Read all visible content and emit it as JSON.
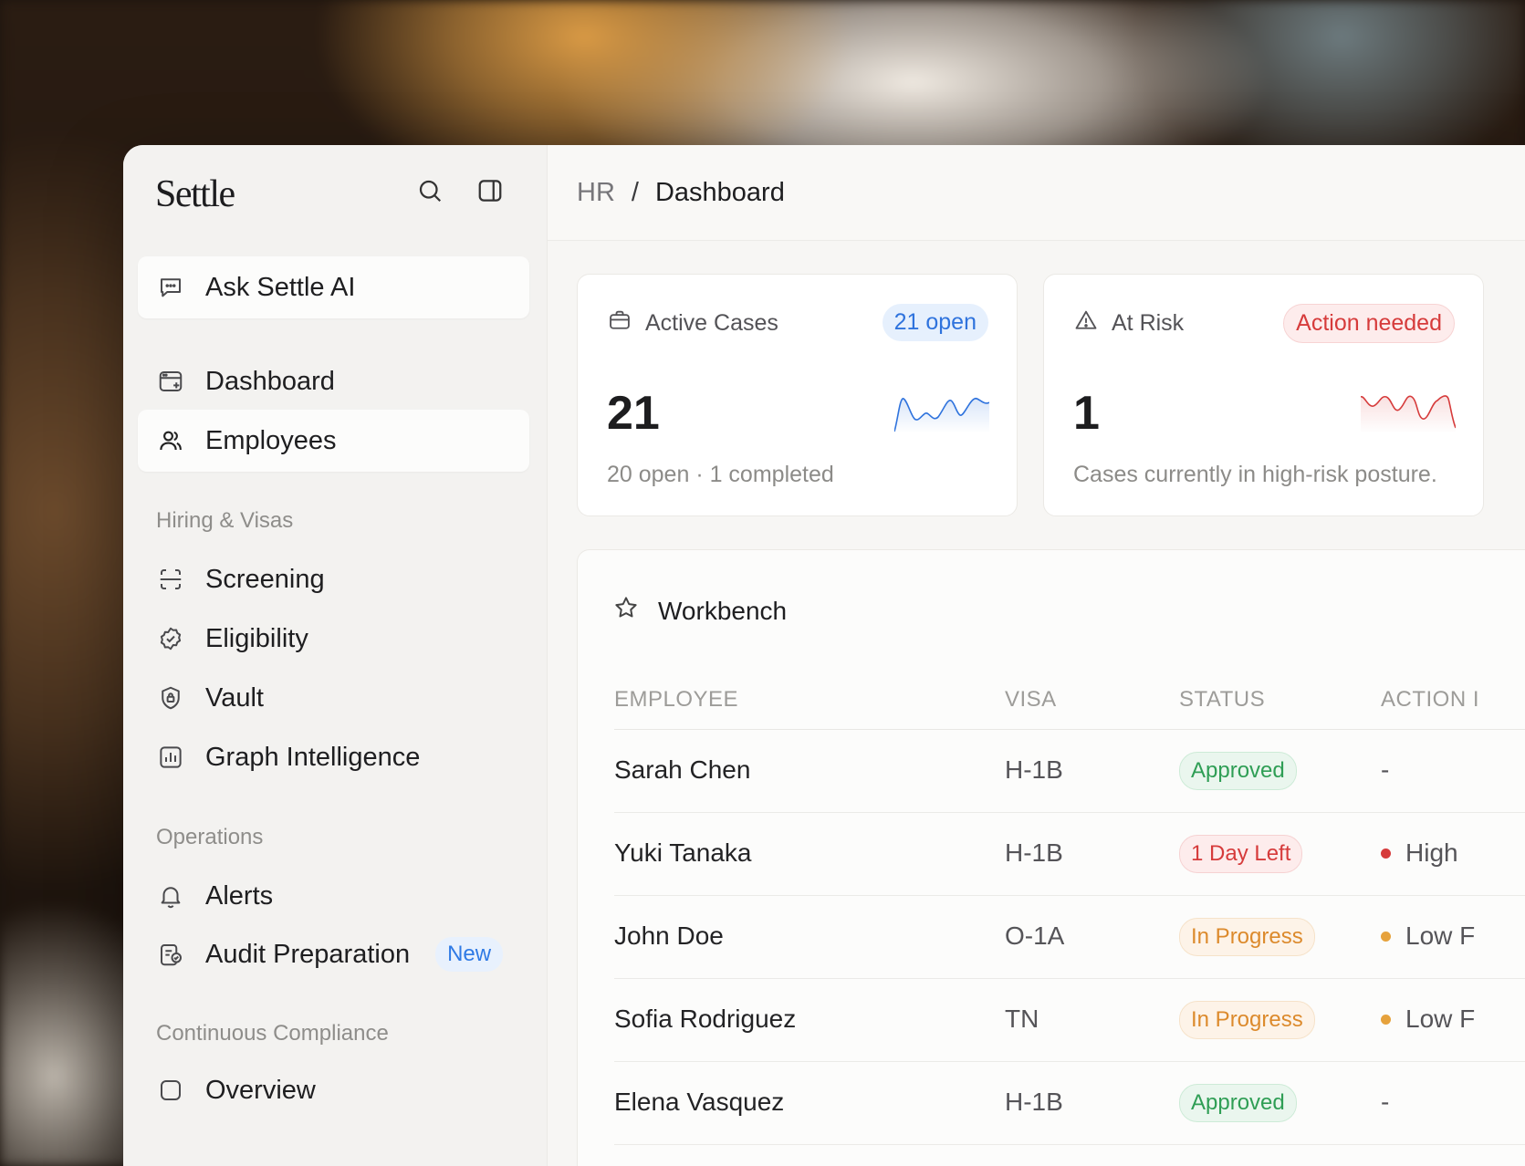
{
  "brand": "Settle",
  "sidebar": {
    "ask_ai": "Ask Settle AI",
    "items": [
      {
        "label": "Dashboard"
      },
      {
        "label": "Employees"
      }
    ],
    "sections": [
      {
        "label": "Hiring & Visas",
        "items": [
          "Screening",
          "Eligibility",
          "Vault",
          "Graph Intelligence"
        ]
      },
      {
        "label": "Operations",
        "items": [
          "Alerts",
          "Audit Preparation"
        ],
        "badge": "New"
      },
      {
        "label": "Continuous Compliance",
        "items": [
          "Overview"
        ]
      }
    ]
  },
  "breadcrumb": {
    "parent": "HR",
    "separator": "/",
    "current": "Dashboard"
  },
  "cards": {
    "active": {
      "title": "Active Cases",
      "pill": "21 open",
      "value": "21",
      "sub": "20 open · 1 completed"
    },
    "risk": {
      "title": "At Risk",
      "pill": "Action needed",
      "value": "1",
      "sub": "Cases currently in high-risk posture."
    }
  },
  "workbench": {
    "title": "Workbench",
    "columns": [
      "EMPLOYEE",
      "VISA",
      "STATUS",
      "ACTION I"
    ],
    "rows": [
      {
        "employee": "Sarah Chen",
        "visa": "H-1B",
        "status": "Approved",
        "action": "-"
      },
      {
        "employee": "Yuki Tanaka",
        "visa": "H-1B",
        "status": "1 Day Left",
        "action": "High"
      },
      {
        "employee": "John Doe",
        "visa": "O-1A",
        "status": "In Progress",
        "action": "Low F"
      },
      {
        "employee": "Sofia Rodriguez",
        "visa": "TN",
        "status": "In Progress",
        "action": "Low F"
      },
      {
        "employee": "Elena Vasquez",
        "visa": "H-1B",
        "status": "Approved",
        "action": "-"
      }
    ]
  },
  "colors": {
    "accent_blue": "#2f73dd",
    "danger_red": "#d63b3b",
    "success_green": "#2f9e55",
    "warning_orange": "#dc8a2c"
  },
  "icons": {
    "search": "search-icon",
    "sidebar_toggle": "sidebar-toggle-icon",
    "chat": "chat-icon",
    "dashboard": "dashboard-icon",
    "employees": "users-icon",
    "screening": "scan-icon",
    "eligibility": "badge-check-icon",
    "vault": "shield-lock-icon",
    "graph": "chart-icon",
    "alerts": "bell-icon",
    "audit": "clipboard-icon",
    "briefcase": "briefcase-icon",
    "warning": "warning-icon",
    "star": "star-icon"
  }
}
